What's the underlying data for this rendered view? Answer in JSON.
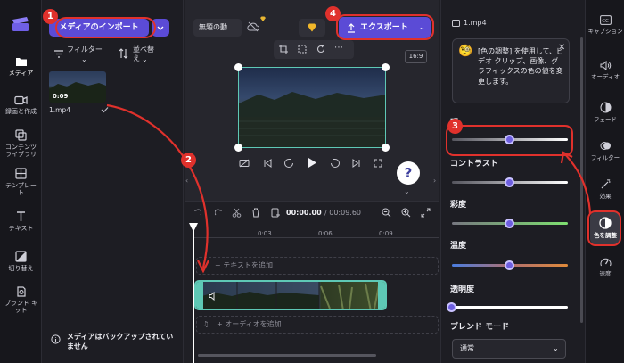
{
  "nav": {
    "items": [
      {
        "label": "メディア",
        "icon": "folder-icon"
      },
      {
        "label": "録画と作成",
        "icon": "camera-icon"
      },
      {
        "label": "コンテンツ ライブラリ",
        "icon": "library-icon"
      },
      {
        "label": "テンプレート",
        "icon": "template-icon"
      },
      {
        "label": "テキスト",
        "icon": "text-icon"
      },
      {
        "label": "切り替え",
        "icon": "transition-icon"
      },
      {
        "label": "ブランド キット",
        "icon": "brand-kit-icon"
      }
    ]
  },
  "media": {
    "import_label": "メディアのインポート",
    "filter_label": "フィルター",
    "sort_label": "並べ替え",
    "clip_duration": "0:09",
    "clip_name": "1.mp4",
    "backup_notice": "メディアはバックアップされていません"
  },
  "header": {
    "project_name": "無題の動",
    "export_label": "エクスポート"
  },
  "preview": {
    "aspect_ratio": "16:9",
    "help_label": "?"
  },
  "timeline": {
    "current_time": "00:00.00",
    "total_time": "/ 00:09.60",
    "ticks": [
      "0:03",
      "0:06",
      "0:09"
    ],
    "add_text": "+ テキストを追加",
    "add_audio": "+ オーディオを追加"
  },
  "props": {
    "file_name": "1.mp4",
    "tip_text": "[色の調整] を使用して、ビデオ クリップ、画像、グラフィックスの色の値を変更します。",
    "sliders": [
      {
        "label": "明",
        "value": 0.5
      },
      {
        "label": "コントラスト",
        "value": 0.5
      },
      {
        "label": "彩度",
        "value": 0.5
      },
      {
        "label": "温度",
        "value": 0.5
      },
      {
        "label": "透明度",
        "value": 0.0
      }
    ],
    "blend_mode_label": "ブレンド モード",
    "blend_mode_value": "通常"
  },
  "rail": {
    "items": [
      {
        "label": "キャプション",
        "icon": "captions-icon"
      },
      {
        "label": "オーディオ",
        "icon": "speaker-icon"
      },
      {
        "label": "フェード",
        "icon": "fade-icon"
      },
      {
        "label": "フィルター",
        "icon": "filter-icon"
      },
      {
        "label": "効果",
        "icon": "magic-wand-icon"
      },
      {
        "label": "色を調整",
        "icon": "color-adjust-icon"
      },
      {
        "label": "速度",
        "icon": "speed-icon"
      }
    ]
  },
  "annotations": {
    "steps": [
      "1",
      "2",
      "3",
      "4"
    ],
    "accent_color": "#e0312c",
    "brand_color": "#5b4bd6"
  }
}
